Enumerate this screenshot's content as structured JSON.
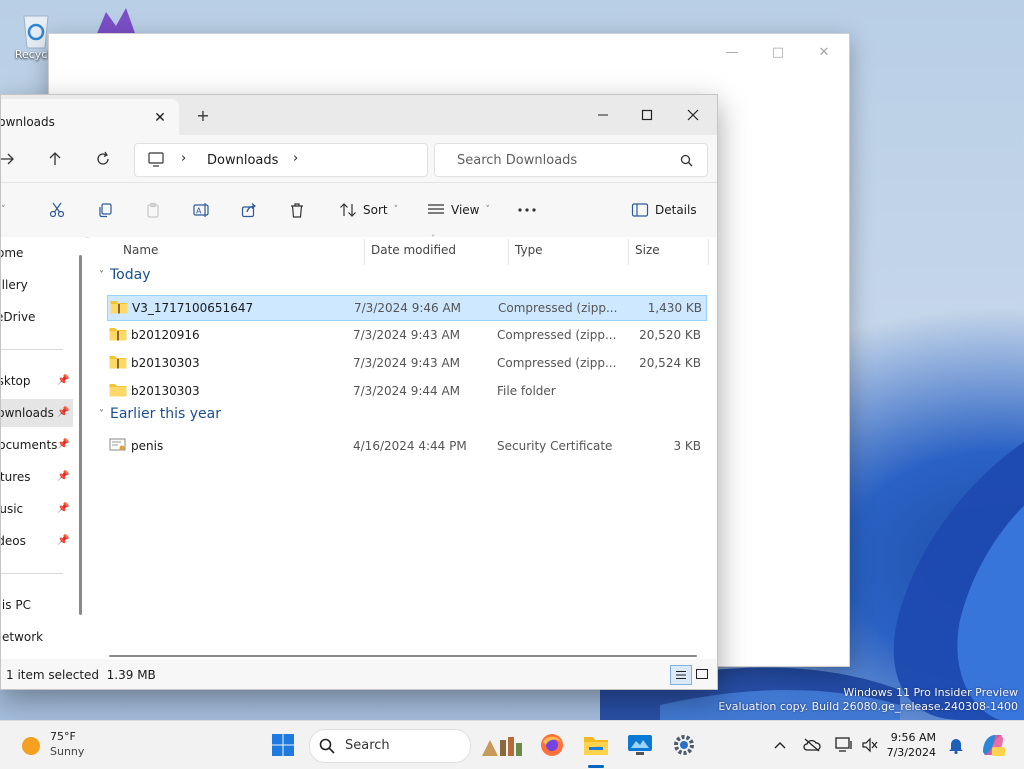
{
  "desktop": {
    "recycle_bin_label": "Recycle",
    "watermark_line1": "Windows 11 Pro Insider Preview",
    "watermark_line2": "Evaluation copy. Build 26080.ge_release.240308-1400"
  },
  "explorer": {
    "tab_title": "Downloads",
    "breadcrumb": "Downloads",
    "search_placeholder": "Search Downloads",
    "toolbar": {
      "sort_label": "Sort",
      "view_label": "View",
      "details_label": "Details"
    },
    "nav_items": [
      "Home",
      "Gallery",
      "OneDrive",
      "Desktop",
      "Downloads",
      "Documents",
      "Pictures",
      "Music",
      "Videos",
      "This PC",
      "Network"
    ],
    "columns": {
      "name": "Name",
      "date": "Date modified",
      "type": "Type",
      "size": "Size"
    },
    "groups": [
      {
        "title": "Today",
        "files": [
          {
            "name": "V3_1717100651647",
            "date": "7/3/2024 9:46 AM",
            "type": "Compressed (zipp...",
            "size": "1,430 KB",
            "icon": "zip-folder-icon",
            "selected": true
          },
          {
            "name": "b20120916",
            "date": "7/3/2024 9:43 AM",
            "type": "Compressed (zipp...",
            "size": "20,520 KB",
            "icon": "zip-folder-icon",
            "selected": false
          },
          {
            "name": "b20130303",
            "date": "7/3/2024 9:43 AM",
            "type": "Compressed (zipp...",
            "size": "20,524 KB",
            "icon": "zip-folder-icon",
            "selected": false
          },
          {
            "name": "b20130303",
            "date": "7/3/2024 9:44 AM",
            "type": "File folder",
            "size": "",
            "icon": "folder-icon",
            "selected": false
          }
        ]
      },
      {
        "title": "Earlier this year",
        "files": [
          {
            "name": "penis",
            "date": "4/16/2024 4:44 PM",
            "type": "Security Certificate",
            "size": "3 KB",
            "icon": "certificate-icon",
            "selected": false
          }
        ]
      }
    ],
    "status": {
      "selection": "1 item selected",
      "size": "1.39 MB"
    }
  },
  "taskbar": {
    "weather_temp": "75°F",
    "weather_cond": "Sunny",
    "search_label": "Search",
    "time": "9:56 AM",
    "date": "7/3/2024"
  },
  "colors": {
    "accent": "#0067c0",
    "selection": "#cde8ff",
    "group_header": "#1a4f8f"
  }
}
